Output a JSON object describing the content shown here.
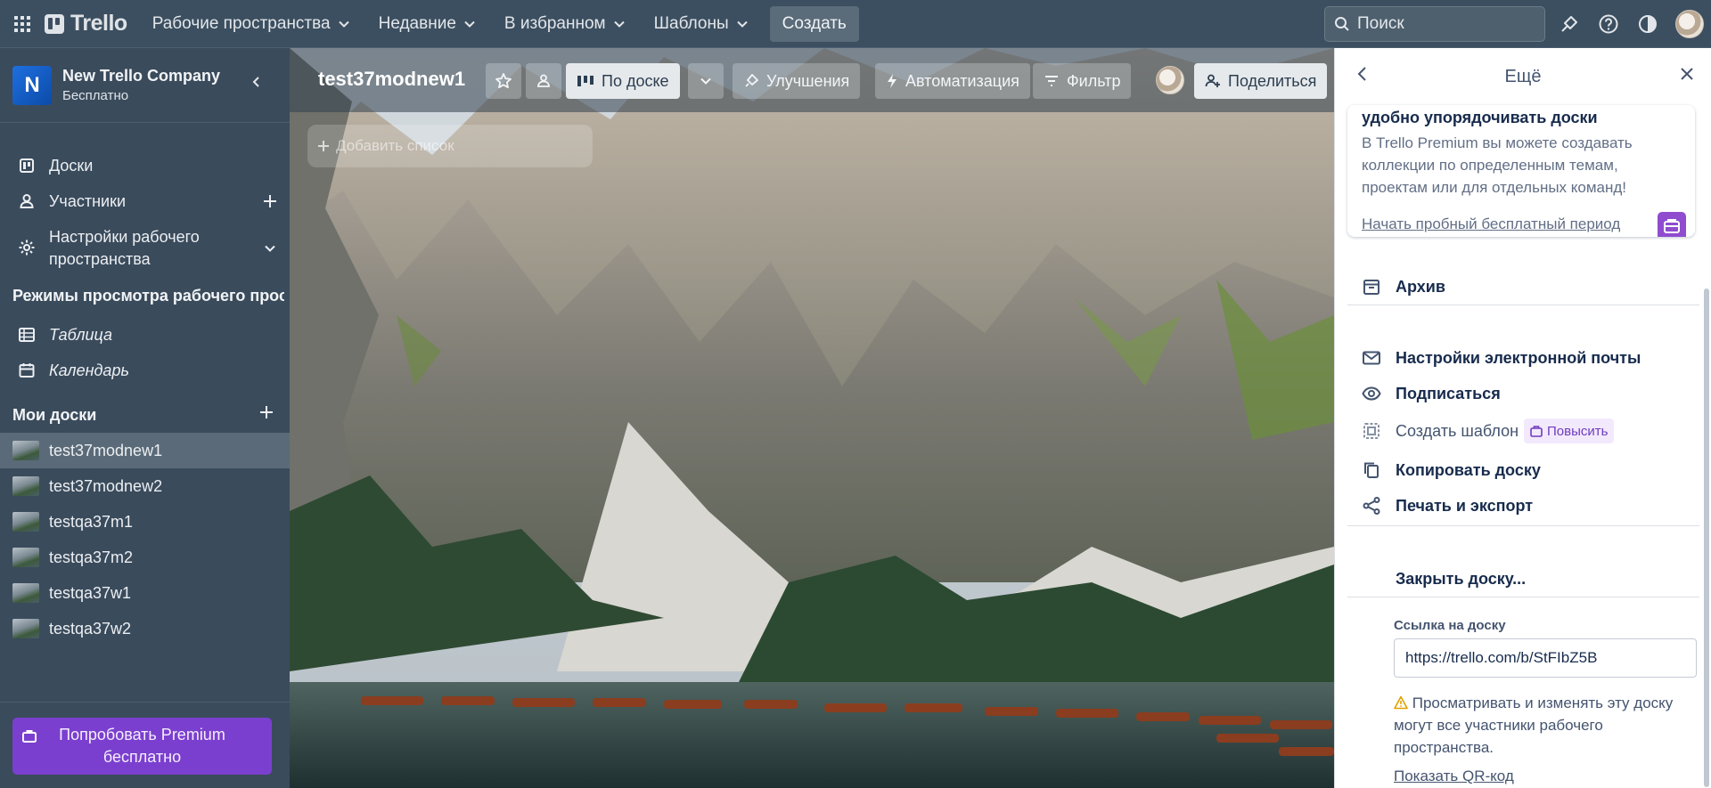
{
  "topbar": {
    "logo_text": "Trello",
    "menu": [
      {
        "label": "Рабочие пространства"
      },
      {
        "label": "Недавние"
      },
      {
        "label": "В избранном"
      },
      {
        "label": "Шаблоны"
      }
    ],
    "create_label": "Создать",
    "search_placeholder": "Поиск"
  },
  "sidebar": {
    "workspace_initial": "N",
    "workspace_name": "New Trello Company",
    "workspace_plan": "Бесплатно",
    "items": [
      {
        "label": "Доски"
      },
      {
        "label": "Участники"
      },
      {
        "label": "Настройки рабочего"
      },
      {
        "label": "пространства"
      }
    ],
    "views_title": "Режимы просмотра рабочего прос...",
    "views": [
      {
        "label": "Таблица"
      },
      {
        "label": "Календарь"
      }
    ],
    "my_boards_title": "Мои доски",
    "boards": [
      {
        "label": "test37modnew1"
      },
      {
        "label": "test37modnew2"
      },
      {
        "label": "testqa37m1"
      },
      {
        "label": "testqa37m2"
      },
      {
        "label": "testqa37w1"
      },
      {
        "label": "testqa37w2"
      }
    ],
    "premium_line1": "Попробовать Premium",
    "premium_line2": "бесплатно"
  },
  "board": {
    "title": "test37modnew1",
    "view_label": "По доске",
    "powerups_label": "Улучшения",
    "automation_label": "Автоматизация",
    "filter_label": "Фильтр",
    "share_label": "Поделиться",
    "add_list_label": "Добавить список"
  },
  "panel": {
    "title": "Ещё",
    "promo_title": "удобно упорядочивать доски",
    "promo_line1": "В Trello Premium вы можете создавать",
    "promo_line2": "коллекции по определенным темам,",
    "promo_line3": "проектам или для отдельных команд!",
    "promo_link": "Начать пробный бесплатный период",
    "archive": "Архив",
    "email_settings": "Настройки электронной почты",
    "subscribe": "Подписаться",
    "create_template": "Создать шаблон",
    "upgrade": "Повысить",
    "copy_board": "Копировать доску",
    "print_export": "Печать и экспорт",
    "close_board": "Закрыть доску...",
    "link_label": "Ссылка на доску",
    "link_value": "https://trello.com/b/StFIbZ5B",
    "warn_line1": "Просматривать и изменять эту доску",
    "warn_line2": "могут все участники рабочего",
    "warn_line3": "пространства.",
    "qr_link": "Показать QR-код"
  },
  "colors": {
    "topbar": "#3c4f60",
    "sidebar": "#3a4b5c",
    "premium": "#7b3fcf",
    "workspace_logo": "#1f6fe0",
    "upgrade_badge": "#8f4ccf"
  }
}
